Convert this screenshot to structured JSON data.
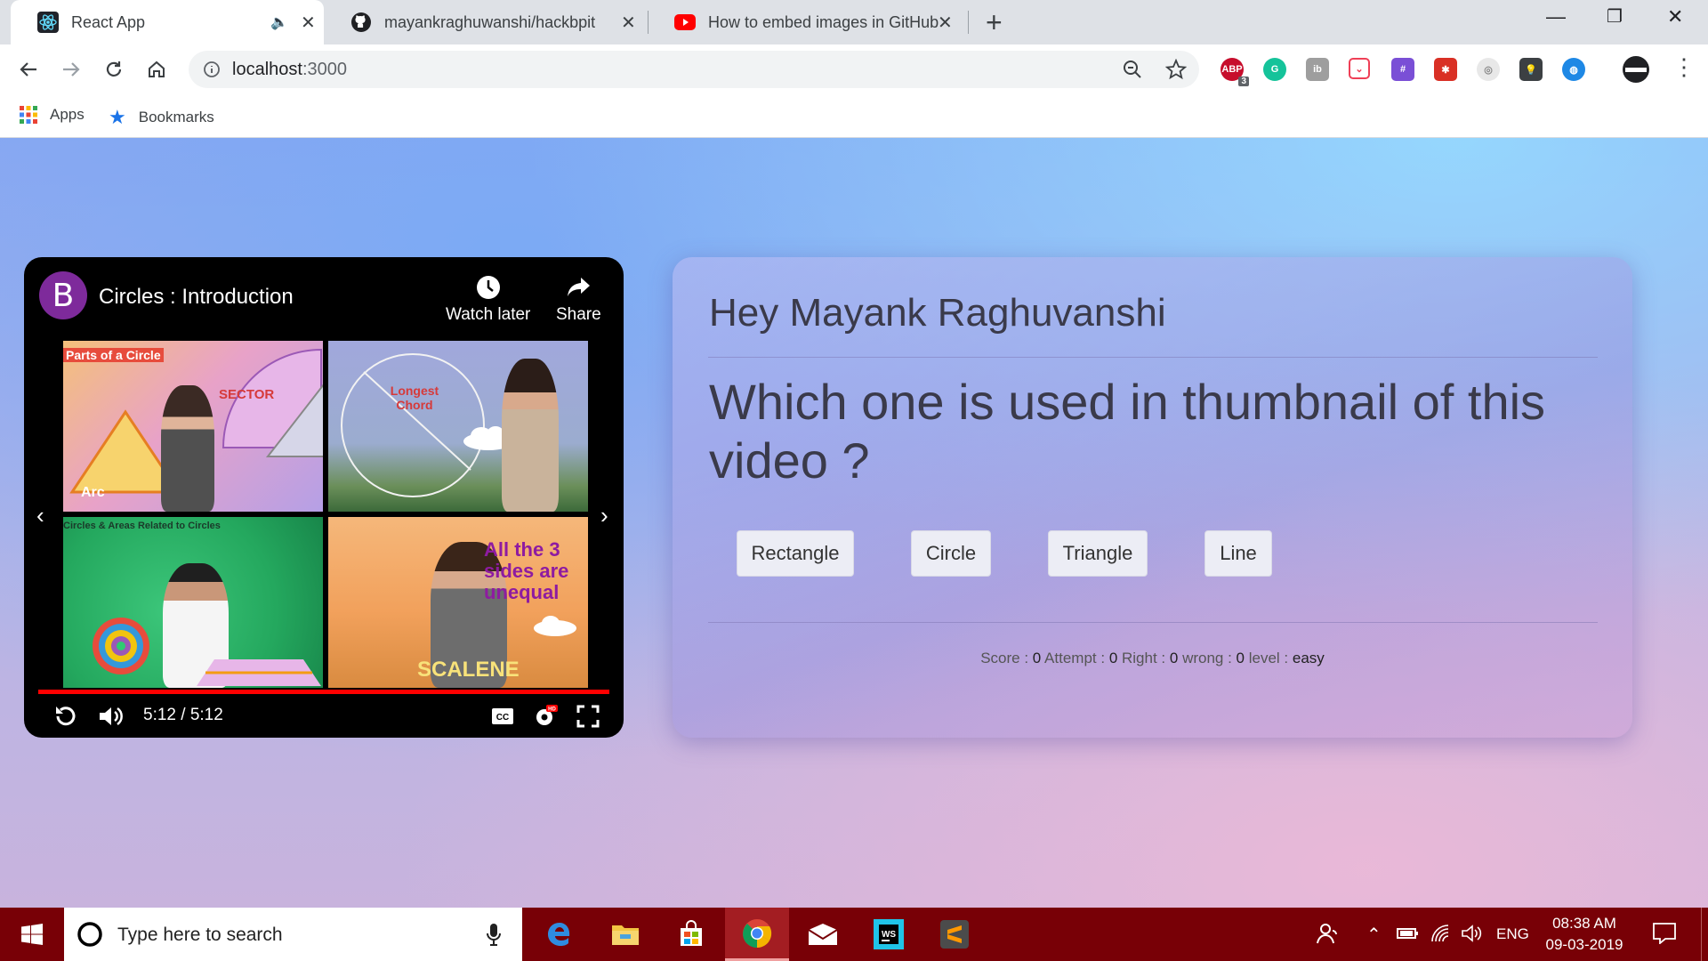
{
  "browser": {
    "tabs": [
      {
        "title": "React App",
        "icon": "react-icon"
      },
      {
        "title": "mayankraghuwanshi/hackbpit",
        "icon": "github-icon"
      },
      {
        "title": "How to embed images in GitHub",
        "icon": "youtube-icon"
      }
    ],
    "url_host": "localhost",
    "url_port": ":3000",
    "bookmarks": {
      "apps": "Apps",
      "bookmarks": "Bookmarks"
    },
    "extensions": [
      {
        "name": "adblock-icon",
        "label": "ABP",
        "color": "#c70d2c"
      },
      {
        "name": "grammarly-icon",
        "label": "G",
        "color": "#15c39a"
      },
      {
        "name": "ib-icon",
        "label": "ib",
        "color": "#9e9e9e"
      },
      {
        "name": "pocket-icon",
        "label": "",
        "color": "#ef3f56"
      },
      {
        "name": "ext-purple-icon",
        "label": "",
        "color": "#7a4fd6"
      },
      {
        "name": "ext-red-icon",
        "label": "",
        "color": "#d93025"
      },
      {
        "name": "ext-circle-icon",
        "label": "",
        "color": "#bdbdbd"
      },
      {
        "name": "bulb-icon",
        "label": "",
        "color": "#3c4043"
      },
      {
        "name": "globe-icon",
        "label": "",
        "color": "#1e88e5"
      }
    ],
    "adblock_count": "3"
  },
  "video": {
    "channel_initial": "B",
    "title": "Circles : Introduction",
    "watch_later": "Watch later",
    "share": "Share",
    "time": "5:12 / 5:12",
    "progress": 1.0,
    "thumbnails": [
      {
        "text1": "Parts of a Circle",
        "text2": "SECTOR",
        "text3": "Arc"
      },
      {
        "text1": "Longest Chord"
      },
      {
        "text1": "Circles & Areas Related to Circles"
      },
      {
        "text1": "All the 3 sides are unequal",
        "text2": "SCALENE"
      }
    ]
  },
  "quiz": {
    "greeting": "Hey Mayank Raghuvanshi",
    "question": "Which one is used in thumbnail of this video ?",
    "options": [
      "Rectangle",
      "Circle",
      "Triangle",
      "Line"
    ],
    "stats": {
      "score_label": "Score : ",
      "score": "0",
      "attempt_label": " Attempt : ",
      "attempt": "0",
      "right_label": " Right : ",
      "right": "0",
      "wrong_label": " wrong : ",
      "wrong": "0",
      "level_label": " level : ",
      "level": "easy"
    }
  },
  "taskbar": {
    "search_placeholder": "Type here to search",
    "language": "ENG",
    "time": "08:38 AM",
    "date": "09-03-2019"
  },
  "colors": {
    "taskbar": "#780006",
    "progress": "#ff0000",
    "channel": "#7e2a9b"
  }
}
